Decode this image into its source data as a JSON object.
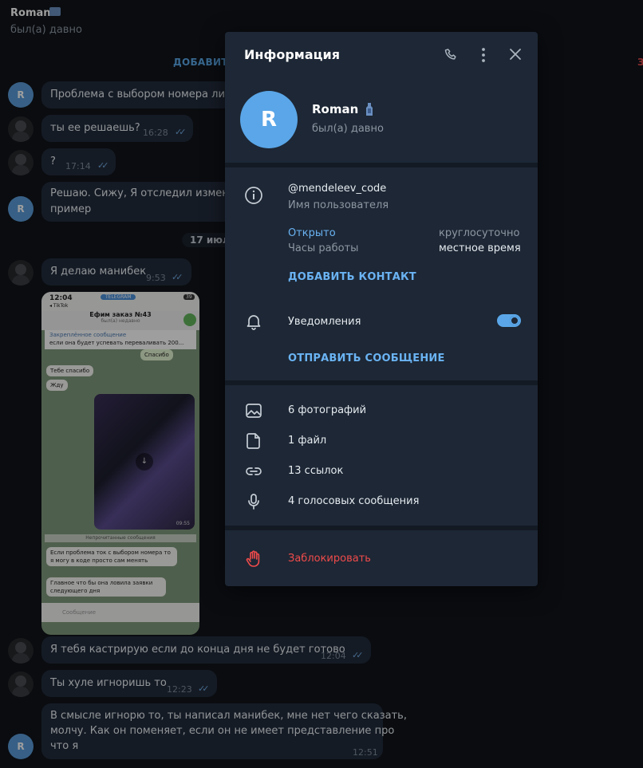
{
  "chat": {
    "name": "Roman",
    "status": "был(а) давно",
    "add_contact": "ДОБАВИТЬ",
    "right_action": "З",
    "date_pill": "17 июл",
    "messages": [
      {
        "text": "Проблема с выбором номера лишь",
        "time": "",
        "ticks": ""
      },
      {
        "text": "ты ее решаешь?",
        "time": "16:28",
        "ticks": "✓✓"
      },
      {
        "text": "?",
        "time": "17:14",
        "ticks": "✓✓"
      },
      {
        "text": "Решаю. Сижу, Я отследил изменяю",
        "text2": "пример",
        "time": "",
        "ticks": ""
      },
      {
        "text": "Я делаю манибек",
        "time": "9:53",
        "ticks": "✓✓"
      },
      {
        "text": "Я тебя кастрирую если до конца дня не будет готово",
        "time": "12:04",
        "ticks": "✓✓"
      },
      {
        "text": "Ты хуле игноришь то",
        "time": "12:23",
        "ticks": "✓✓"
      },
      {
        "text": "В смысле игнорю то, ты написал манибек, мне нет чего сказать,",
        "text2": "молчу. Как он поменяет, если он не имеет представление про",
        "text3": "что я",
        "time": "12:51",
        "ticks": ""
      }
    ],
    "avatar_letter": "R",
    "screenshot": {
      "status_time": "12:04",
      "badge": "TELEGRAM",
      "back_app": "◂ TikTok",
      "battery": "39",
      "title": "Ефим заказ №43",
      "subtitle": "был(а) недавно",
      "pinned_label": "Закреплённое сообщение",
      "pinned_text": "если она будет успевать переваливать 200...",
      "bubble_thanks": "Спасибо",
      "bubble_thanks2": "Тебе спасибо",
      "bubble_wait": "Жду",
      "media_time": "09:55",
      "unread_divider": "Непрочитанные сообщения",
      "msg_a": "Если проблема ток с выбором номера то я могу в коде просто сам менять",
      "msg_b": "Главное что бы она ловила заявки следующего дня",
      "input_placeholder": "Сообщение"
    }
  },
  "panel": {
    "title": "Информация",
    "avatar_letter": "R",
    "name": "Roman",
    "status": "был(а) давно",
    "username": "@mendeleev_code",
    "username_label": "Имя пользователя",
    "hours_status": "Открыто",
    "hours_value": "круглосуточно",
    "hours_label": "Часы работы",
    "hours_local": "местное время",
    "add_contact": "ДОБАВИТЬ КОНТАКТ",
    "notifications": "Уведомления",
    "notifications_on": true,
    "send_message": "ОТПРАВИТЬ СООБЩЕНИЕ",
    "media": [
      {
        "icon": "photo-icon",
        "label": "6 фотографий"
      },
      {
        "icon": "file-icon",
        "label": "1 файл"
      },
      {
        "icon": "link-icon",
        "label": "13 ссылок"
      },
      {
        "icon": "mic-icon",
        "label": "4 голосовых сообщения"
      }
    ],
    "block": "Заблокировать",
    "icons": {
      "call": "phone-icon",
      "more": "more-vertical-icon",
      "close": "close-icon",
      "info": "info-icon",
      "bell": "bell-icon",
      "block": "hand-icon"
    }
  },
  "colors": {
    "accent": "#6ab3f3",
    "danger": "#f04b4b",
    "panel_bg": "#1d2735"
  }
}
